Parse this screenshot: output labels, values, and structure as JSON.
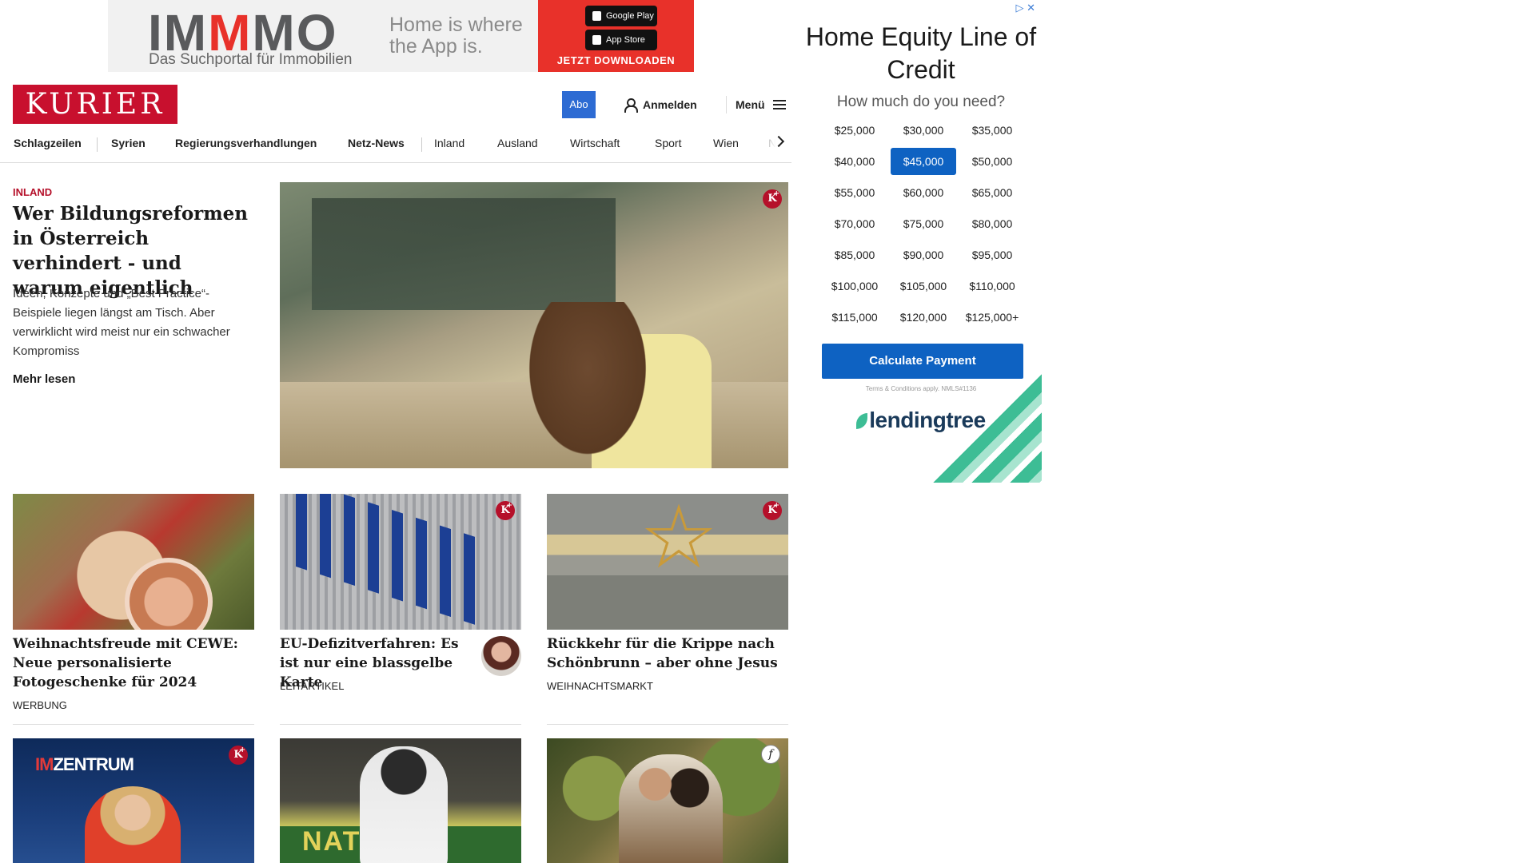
{
  "top_ad": {
    "brand_a": "IM",
    "brand_m": "M",
    "brand_b": "MO",
    "subtitle": "Das Suchportal für Immobilien",
    "tagline": "Home is where the App is.",
    "google_play": "Google Play",
    "app_store": "App Store",
    "cta": "JETZT DOWNLOADEN"
  },
  "header": {
    "logo": "KURIER",
    "abo": "Abo",
    "login": "Anmelden",
    "menu": "Menü"
  },
  "nav": {
    "items": [
      "Schlagzeilen",
      "Syrien",
      "Regierungsverhandlungen",
      "Netz-News",
      "Inland",
      "Ausland",
      "Wirtschaft",
      "Sport",
      "Wien",
      "NÖ"
    ]
  },
  "hero": {
    "kicker": "INLAND",
    "title": "Wer Bildungsreformen in Österreich verhindert - und warum eigentlich",
    "lead": "Ideen, Konzepte und „Best Practice“-Beispiele liegen längst am Tisch. Aber verwirklicht wird meist nur ein schwacher Kompromiss",
    "more": "Mehr lesen"
  },
  "cards": [
    {
      "title": "Weihnachtsfreude mit CEWE: Neue personalisierte Fotogeschenke für 2024",
      "kicker": "WERBUNG"
    },
    {
      "title": "EU-Defizitverfahren: Es ist nur eine blassgelbe Karte",
      "kicker": "LEITARTIKEL"
    },
    {
      "title": "Rückkehr für die Krippe nach Schönbrunn – aber ohne Jesus",
      "kicker": "WEIHNACHTSMARKT"
    }
  ],
  "row2": {
    "zentrum_logo_a": "IM",
    "zentrum_logo_b": "ZENTRUM",
    "ski_banner": "NATSTIF"
  },
  "badges": {
    "kplus": "K",
    "f": "f"
  },
  "side_ad": {
    "adchoice": "▷ ✕",
    "headline": "Home Equity Line of Credit",
    "question": "How much do you need?",
    "amounts": [
      "$25,000",
      "$30,000",
      "$35,000",
      "$40,000",
      "$45,000",
      "$50,000",
      "$55,000",
      "$60,000",
      "$65,000",
      "$70,000",
      "$75,000",
      "$80,000",
      "$85,000",
      "$90,000",
      "$95,000",
      "$100,000",
      "$105,000",
      "$110,000",
      "$115,000",
      "$120,000",
      "$125,000+"
    ],
    "selected": "$45,000",
    "cta": "Calculate Payment",
    "terms": "Terms & Conditions apply. NMLS#1136",
    "brand": "lendingtree"
  },
  "colors": {
    "kurier_red": "#c8102e",
    "abo_blue": "#2d6bd3",
    "lt_blue": "#0e62c2",
    "lt_green": "#3dbd95"
  }
}
